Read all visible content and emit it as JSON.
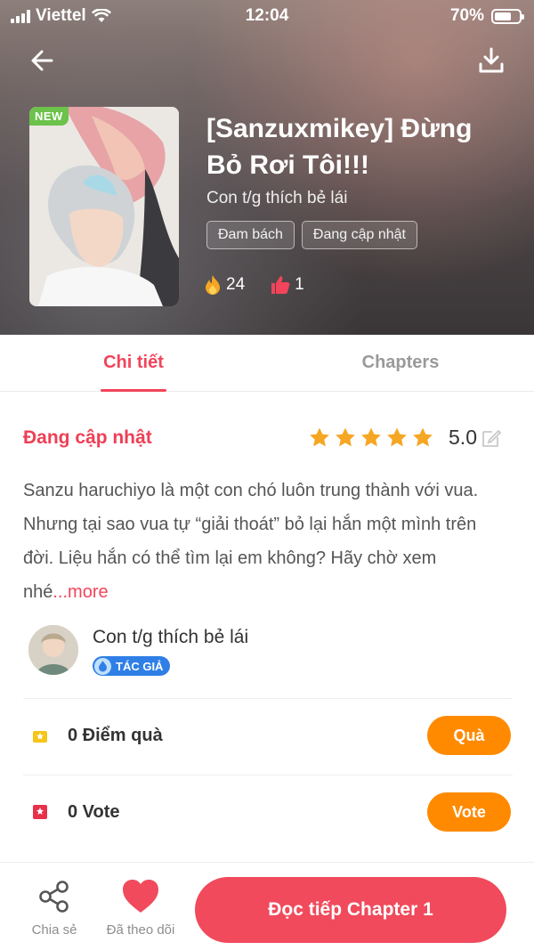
{
  "status_bar": {
    "carrier": "Viettel",
    "time": "12:04",
    "battery": "70%",
    "battery_level": 0.7
  },
  "header": {
    "new_badge": "NEW",
    "title": "[Sanzuxmikey] Đừng Bỏ Rơi Tôi!!!",
    "author": "Con t/g thích bẻ lái",
    "tags": [
      "Đam bách",
      "Đang cập nhật"
    ],
    "fire_count": "24",
    "like_count": "1"
  },
  "tabs": {
    "detail": "Chi tiết",
    "chapters": "Chapters"
  },
  "details": {
    "status": "Đang cập nhật",
    "rating_value": "5.0",
    "rating_stars": 5,
    "description": "Sanzu haruchiyo là một con chó luôn trung thành với vua. Nhưng tại sao vua tự “giải thoát”    bỏ lại hắn một mình trên đời. Liệu hắn có thể tìm lại em không? Hãy chờ xem nhé",
    "more": "...more"
  },
  "author_info": {
    "name": "Con t/g thích bẻ lái",
    "badge": "TÁC GIẢ"
  },
  "gift_row": {
    "label": "0 Điểm quà",
    "button": "Quà"
  },
  "vote_row": {
    "label": "0 Vote",
    "button": "Vote"
  },
  "bottom_bar": {
    "share": "Chia sẻ",
    "follow": "Đã theo dõi",
    "read": "Đọc tiếp Chapter 1"
  },
  "colors": {
    "accent": "#f2445b",
    "orange": "#ff8a00",
    "star": "#f5a623",
    "badge_blue": "#2f7fe6"
  }
}
